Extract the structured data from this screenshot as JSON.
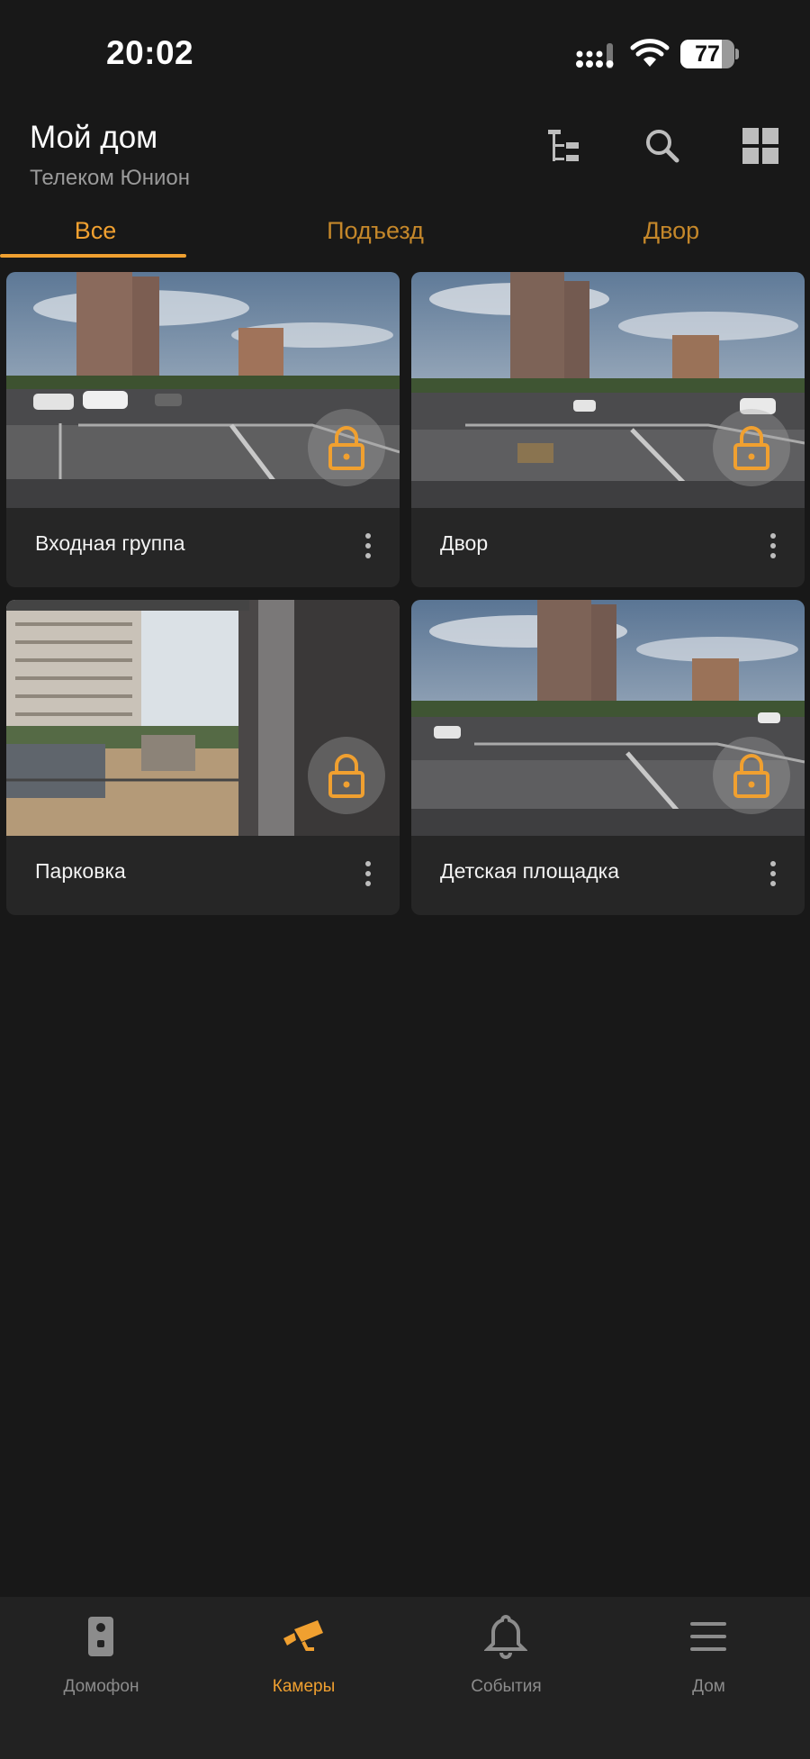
{
  "status_bar": {
    "time": "20:02",
    "battery": "77",
    "battery_level": 0.77
  },
  "header": {
    "title": "Мой дом",
    "subtitle": "Телеком Юнион",
    "icons": [
      "hierarchy-icon",
      "search-icon",
      "grid-view-icon"
    ]
  },
  "tabs": [
    {
      "label": "Все",
      "active": true
    },
    {
      "label": "Подъезд",
      "active": false
    },
    {
      "label": "Двор",
      "active": false
    }
  ],
  "cameras": [
    {
      "label": "Входная группа",
      "icon": "lock-icon"
    },
    {
      "label": "Двор",
      "icon": "lock-icon"
    },
    {
      "label": "Парковка",
      "icon": "lock-icon"
    },
    {
      "label": "Детская площадка",
      "icon": "lock-icon"
    }
  ],
  "bottom_nav": [
    {
      "label": "Домофон",
      "icon": "intercom-icon",
      "active": false
    },
    {
      "label": "Камеры",
      "icon": "camera-icon",
      "active": true
    },
    {
      "label": "События",
      "icon": "bell-icon",
      "active": false
    },
    {
      "label": "Дом",
      "icon": "menu-icon",
      "active": false
    }
  ],
  "colors": {
    "accent": "#f0a030",
    "background": "#181818",
    "card": "#262626",
    "nav": "#222222"
  }
}
